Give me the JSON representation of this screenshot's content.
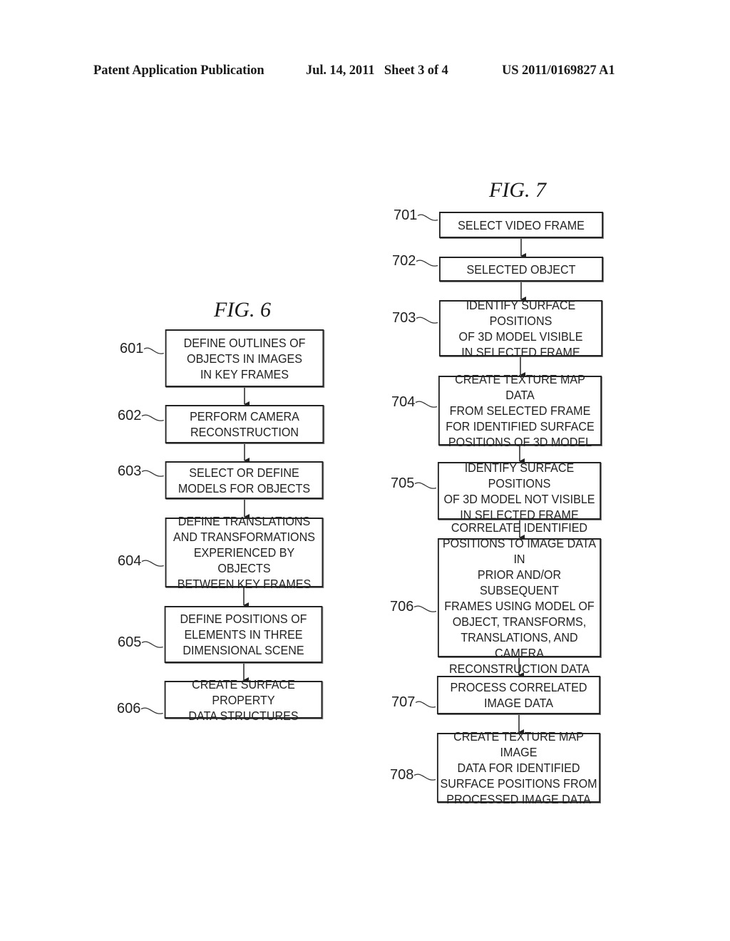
{
  "header": {
    "publication_type": "Patent Application Publication",
    "date_sheet": "Jul. 14, 2011   Sheet 3 of 4",
    "patent_number": "US 2011/0169827 A1"
  },
  "fig6": {
    "title": "FIG. 6",
    "steps": [
      {
        "ref": "601",
        "text": "DEFINE OUTLINES OF\nOBJECTS IN IMAGES\nIN KEY FRAMES"
      },
      {
        "ref": "602",
        "text": "PERFORM CAMERA\nRECONSTRUCTION"
      },
      {
        "ref": "603",
        "text": "SELECT OR DEFINE\nMODELS FOR OBJECTS"
      },
      {
        "ref": "604",
        "text": "DEFINE TRANSLATIONS\nAND TRANSFORMATIONS\nEXPERIENCED BY OBJECTS\nBETWEEN KEY FRAMES"
      },
      {
        "ref": "605",
        "text": "DEFINE POSITIONS OF\nELEMENTS IN THREE\nDIMENSIONAL SCENE"
      },
      {
        "ref": "606",
        "text": "CREATE SURFACE PROPERTY\nDATA STRUCTURES"
      }
    ]
  },
  "fig7": {
    "title": "FIG. 7",
    "steps": [
      {
        "ref": "701",
        "text": "SELECT VIDEO FRAME"
      },
      {
        "ref": "702",
        "text": "SELECTED OBJECT"
      },
      {
        "ref": "703",
        "text": "IDENTIFY SURFACE POSITIONS\nOF 3D MODEL VISIBLE\nIN SELECTED FRAME"
      },
      {
        "ref": "704",
        "text": "CREATE TEXTURE MAP DATA\nFROM SELECTED FRAME\nFOR IDENTIFIED SURFACE\nPOSITIONS OF 3D MODEL"
      },
      {
        "ref": "705",
        "text": "IDENTIFY SURFACE POSITIONS\nOF 3D MODEL NOT VISIBLE\nIN SELECTED FRAME"
      },
      {
        "ref": "706",
        "text": "CORRELATE IDENTIFIED\nPOSITIONS TO IMAGE DATA IN\nPRIOR AND/OR SUBSEQUENT\nFRAMES USING MODEL OF\nOBJECT, TRANSFORMS,\nTRANSLATIONS, AND CAMERA\nRECONSTRUCTION DATA"
      },
      {
        "ref": "707",
        "text": "PROCESS CORRELATED\nIMAGE DATA"
      },
      {
        "ref": "708",
        "text": "CREATE TEXTURE MAP IMAGE\nDATA FOR IDENTIFIED\nSURFACE POSITIONS FROM\nPROCESSED IMAGE DATA"
      }
    ]
  }
}
